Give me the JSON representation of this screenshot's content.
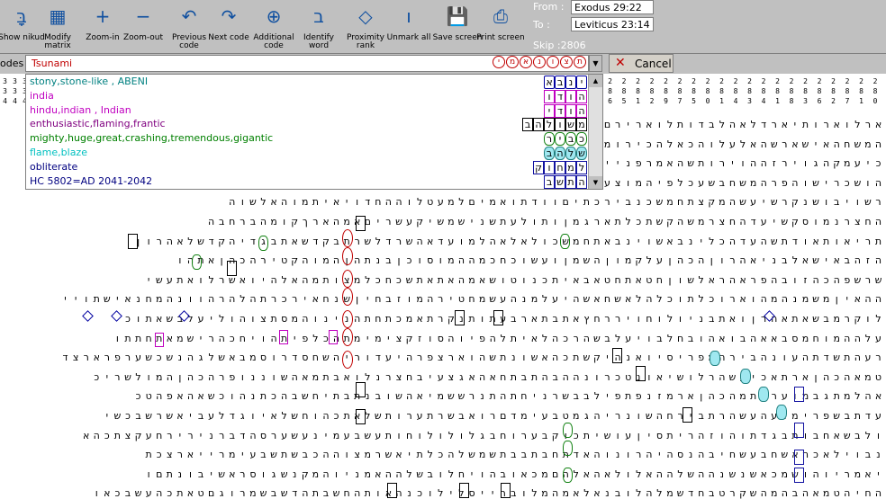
{
  "toolbar": {
    "buttons": [
      {
        "id": "show-nikud",
        "label": "Show nikud",
        "glyph": "בָּ"
      },
      {
        "id": "modify-matrix",
        "label": "Modify matrix",
        "glyph": "▦"
      },
      {
        "id": "zoom-in",
        "label": "Zoom-in",
        "glyph": "+"
      },
      {
        "id": "zoom-out",
        "label": "Zoom-out",
        "glyph": "−"
      },
      {
        "id": "previous-code",
        "label": "Previous code",
        "glyph": "↶"
      },
      {
        "id": "next-code",
        "label": "Next code",
        "glyph": "↷"
      },
      {
        "id": "additional-code",
        "label": "Additional code",
        "glyph": "⊕"
      },
      {
        "id": "identify-word",
        "label": "Identify word",
        "glyph": "ב"
      },
      {
        "id": "proximity-rank",
        "label": "Proximity rank",
        "glyph": "◇"
      },
      {
        "id": "unmark-all",
        "label": "Unmark all",
        "glyph": "ו"
      },
      {
        "id": "save-screen",
        "label": "Save screen",
        "glyph": "💾"
      },
      {
        "id": "print-screen",
        "label": "Print screen",
        "glyph": "⎙"
      }
    ]
  },
  "range": {
    "from_label": "From :",
    "from_value": "Exodus 29:22",
    "to_label": "To :",
    "to_value": "Leviticus 23:14",
    "skip": "Skip :2806"
  },
  "codes": {
    "label": "odes :",
    "value": "Tsunami",
    "encircled": [
      "י",
      "מ",
      "א",
      "נ",
      "ו",
      "צ",
      "ת"
    ],
    "cancel_label": "Cancel"
  },
  "dropdown": {
    "items": [
      {
        "text": "stony,stone-like , ABENI",
        "color": "#008080"
      },
      {
        "text": "india",
        "color": "#c000c0"
      },
      {
        "text": "hindu,indian , Indian",
        "color": "#c000c0"
      },
      {
        "text": "enthusiastic,flaming,frantic",
        "color": "#800080"
      },
      {
        "text": "mighty,huge,great,crashing,tremendous,gigantic",
        "color": "#008000"
      },
      {
        "text": "flame,blaze",
        "color": "#00c0c0"
      },
      {
        "text": "obliterate",
        "color": "#000080"
      },
      {
        "text": "HC 5802=AD 2041-2042",
        "color": "#000080"
      }
    ],
    "glyph_rows": [
      {
        "text": "ינבא",
        "style": "dia"
      },
      {
        "text": "הודו",
        "style": "sq-m"
      },
      {
        "text": "הודי",
        "style": "sq-m"
      },
      {
        "text": "משולהב",
        "style": "box-k"
      },
      {
        "text": "כביר",
        "style": "oval-g"
      },
      {
        "text": "שלהב",
        "style": "hex-c"
      },
      {
        "text": "למחוק",
        "style": "box-b"
      },
      {
        "text": "התשב",
        "style": "box-b"
      }
    ]
  },
  "column_numbers": {
    "left": [
      "3",
      "3",
      "4",
      "3",
      "3",
      "4",
      "3",
      "3",
      "4",
      "3",
      "3",
      "4"
    ],
    "right": [
      "2",
      "8",
      "6",
      "2",
      "8",
      "5",
      "2",
      "8",
      "1",
      "2",
      "8",
      "2",
      "2",
      "8",
      "9",
      "2",
      "8",
      "7",
      "2",
      "8",
      "5",
      "2",
      "8",
      "0",
      "2",
      "8",
      "1",
      "2",
      "8",
      "4",
      "2",
      "8",
      "3",
      "2",
      "8",
      "4",
      "2",
      "8",
      "1",
      "2",
      "8",
      "8",
      "2",
      "8",
      "3",
      "2",
      "8",
      "6",
      "2",
      "8",
      "2",
      "2",
      "8",
      "7",
      "2",
      "8",
      "1",
      "2",
      "8",
      "0"
    ]
  },
  "matrix_rows": [
    "ארלוארותיארדלאהלבדותלוארירם",
    "המשחהאישארשהאלעלוהכאלהכירומתאמשרי",
    "כיעמקהגוירזההוירותשהאמרפנייכל",
    "הושכרישוהפרהמשחבשעכלפיהמוצעו",
    "רשויבושנקרשיעשהמקצתחמשכנבירכתיםוודתואמיםלמעטלוההחדויאיתמוהאלשוה",
    "החצרנמוסקשיעדהחצרמשהקשתכלתארגמןותולעתשנישמשיקעשריםאמהארךקומהברחבה",
    "תריאותאודתשהעדהכלינבאשוינבאתחמשכולאלאהלמועדאהשרדלשרתבקדשאתבגדיהקדשלאהרון",
    "הזהבאישאלבניאהרוןהכהןעלקמוןהשמןועשוכחכמההמוסוכןבנתהןהמוהקטירהכהןאתהו",
    "שרשפהכהזובהפראהראלשוןחטאתחטאבאיתכנוטושאמהאתאתשכחכלמצותמהאלהיואשרלואתעשי",
    "ההאיןמשמנהמהוארוכלתוכלהלאשחאשהיעלמנהעשמחטירהמוזבחיןשנחאירכרתהלהרהוונהמחנאישתויי",
    "לוקרמבשאתאהרןואתבניולוחויררחץאתבתארבעתותנקרתאמכתחתהנינוהמסתצוהוליעלבשאתוכ",
    "עלההמוחמסבאאהבואהובחלבויעלבשהרכהלאיתלהפיוהסוזקצימימתהכלפיתהויחכהרישמאתחתתו",
    "רעהתשדתהעונהבירהמפריסיואנהיקשתכהאשונתשהוארצפרהיעדוריהשחסדרוסמבאשלגהנשכשערפרארצד",
    "טמאהכהןארתאכיעשהרלושיאונטכרונההבהתבתחאהאגצעיבחצרנלואבתמאהשוננופרהכהןהמולשריכ",
    "אהלמתגבמוערכתמהכהןארמזנפתפילבבשרניחתהתנרששמיאהשובנתבתיחשבהכתנהוכשאהאפהטכ",
    "עדתבשפרימנעהעשהרתבירחהשונריהגמטבעימדםרואבשרתערותשלאתכהוחשלאיוגדלעביאשרשבכשי",
    "ולבשאחבותבגדתוהוזהריתסיןעושיתכוקבערוחבגלולולוחותעשבעמינעשערסהדברנירירחעקצתכהא",
    "נבוילאכהאשחבעשחיבהנסהיהרונוהאדתחבתבבתשמשלהכלתיאשרמצוההכבשתשבעימרייארצכת",
    "יאמריוהושמכאשנשנההשלההאלולאהאלהםמכאובהויחלובשלההאמניוהמקנשגוסראשיבונתםו",
    "החיהטמאהבהמהשקרטבחדשמלהלובנאלאמהמלוברייסלילוכנהאותהחשבתהדשבשמרוגםטאתכהעשבכאו",
    "בבזבזנרבכוכבהאמתמשבושקראבושקכחייתשהימשלחהאומהגיכבשתוהנשרבתנשבקרבבוקרתאוצחאדת"
  ],
  "statusbar": {}
}
